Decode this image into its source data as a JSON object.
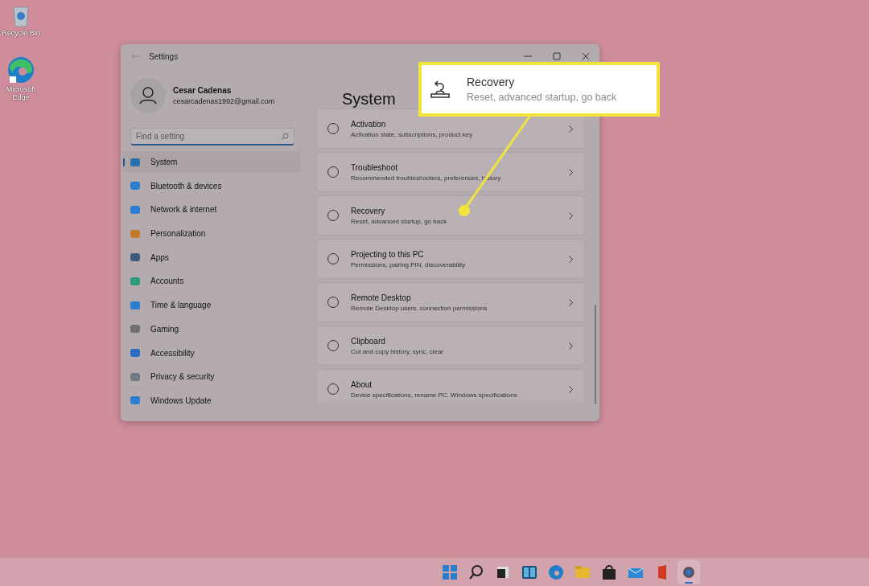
{
  "desktop_icons": [
    {
      "label": "Recycle Bin",
      "kind": "bin"
    },
    {
      "label": "Microsoft Edge",
      "kind": "edge"
    }
  ],
  "window": {
    "title": "Settings"
  },
  "profile": {
    "name": "Cesar Cadenas",
    "email": "cesarcadenas1992@gmail.com"
  },
  "search": {
    "placeholder": "Find a setting"
  },
  "sidebar": {
    "items": [
      {
        "label": "System",
        "selected": true
      },
      {
        "label": "Bluetooth & devices",
        "selected": false
      },
      {
        "label": "Network & internet",
        "selected": false
      },
      {
        "label": "Personalization",
        "selected": false
      },
      {
        "label": "Apps",
        "selected": false
      },
      {
        "label": "Accounts",
        "selected": false
      },
      {
        "label": "Time & language",
        "selected": false
      },
      {
        "label": "Gaming",
        "selected": false
      },
      {
        "label": "Accessibility",
        "selected": false
      },
      {
        "label": "Privacy & security",
        "selected": false
      },
      {
        "label": "Windows Update",
        "selected": false
      }
    ]
  },
  "page_title": "System",
  "settings": [
    {
      "title": "Activation",
      "subtitle": "Activation state, subscriptions, product key"
    },
    {
      "title": "Troubleshoot",
      "subtitle": "Recommended troubleshooters, preferences, history"
    },
    {
      "title": "Recovery",
      "subtitle": "Reset, advanced startup, go back"
    },
    {
      "title": "Projecting to this PC",
      "subtitle": "Permissions, pairing PIN, discoverability"
    },
    {
      "title": "Remote Desktop",
      "subtitle": "Remote Desktop users, connection permissions"
    },
    {
      "title": "Clipboard",
      "subtitle": "Cut and copy history, sync, clear"
    },
    {
      "title": "About",
      "subtitle": "Device specifications, rename PC, Windows specifications"
    }
  ],
  "callout": {
    "title": "Recovery",
    "subtitle": "Reset, advanced startup, go back"
  },
  "taskbar": {
    "apps": [
      {
        "selected": false
      },
      {
        "selected": false
      },
      {
        "selected": false
      },
      {
        "selected": false
      },
      {
        "selected": false
      },
      {
        "selected": false
      },
      {
        "selected": false
      },
      {
        "selected": false
      },
      {
        "selected": false
      },
      {
        "selected": true
      }
    ]
  }
}
